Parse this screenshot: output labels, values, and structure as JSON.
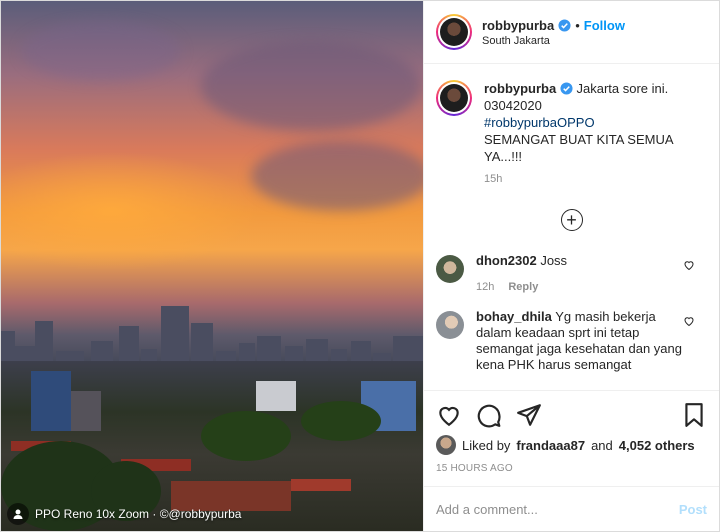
{
  "post": {
    "username": "robbypurba",
    "follow_label": "Follow",
    "separator": "•",
    "location": "South Jakarta",
    "photo_caption_overlay": "PPO Reno 10x Zoom · ©@robbypurba"
  },
  "caption": {
    "username": "robbypurba",
    "text_line1": "Jakarta sore ini.",
    "text_line2": "03042020",
    "hashtag": "#robbypurbaOPPO",
    "text_line3": "SEMANGAT BUAT KITA SEMUA YA...!!!",
    "time": "15h"
  },
  "load_more_icon": "plus-circle-icon",
  "comments": [
    {
      "username": "dhon2302",
      "text": "Joss",
      "time": "12h",
      "reply_label": "Reply"
    },
    {
      "username": "bohay_dhila",
      "text": "Yg masih bekerja dalam keadaan sprt ini tetap semangat jaga kesehatan dan yang kena PHK harus semangat",
      "time": "",
      "reply_label": ""
    }
  ],
  "actions": {
    "icons": [
      "heart-icon",
      "comment-icon",
      "share-icon",
      "bookmark-icon"
    ]
  },
  "likes": {
    "prefix": "Liked by",
    "user": "frandaaa87",
    "and": "and",
    "others": "4,052 others"
  },
  "timestamp": "15 HOURS AGO",
  "add_comment": {
    "placeholder": "Add a comment...",
    "post_label": "Post"
  },
  "colors": {
    "link_blue": "#0095f6",
    "hashtag_blue": "#00376b",
    "muted": "#8e8e8e",
    "post_disabled": "#b2dffc"
  }
}
